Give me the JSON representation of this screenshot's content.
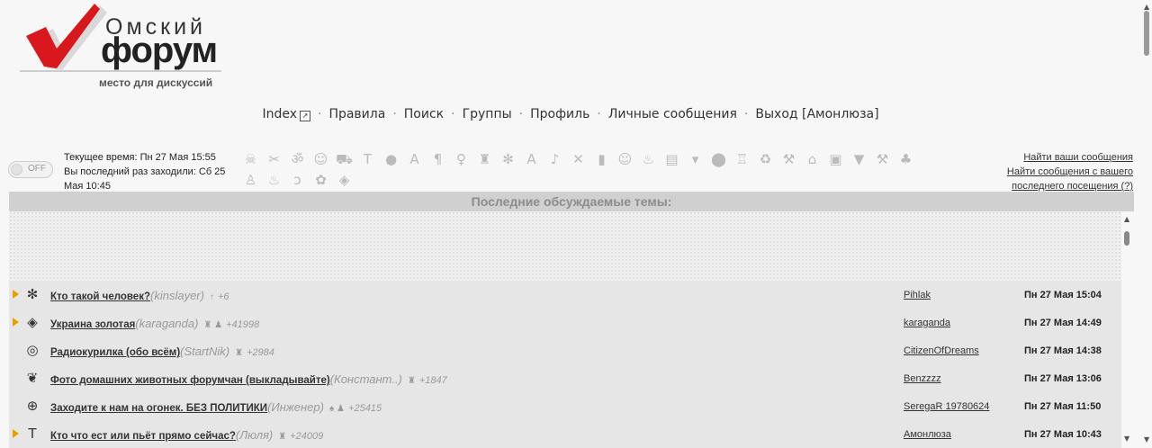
{
  "logo": {
    "small": "Омский",
    "big": "форум",
    "tagline": "место для дискуссий"
  },
  "nav": {
    "items": [
      {
        "label": "Index"
      },
      {
        "label": "Правила"
      },
      {
        "label": "Поиск"
      },
      {
        "label": "Группы"
      },
      {
        "label": "Профиль"
      },
      {
        "label": "Личные сообщения"
      },
      {
        "label": "Выход [Амонлюза]"
      }
    ],
    "separator": "·"
  },
  "toggle": {
    "label": "OFF"
  },
  "timeinfo": {
    "current": "Текущее время: Пн 27 Мая 15:55",
    "last_visit": "Вы последний раз заходили: Сб 25 Мая 10:45"
  },
  "icons": [
    "skull-icon",
    "scissors-icon",
    "om-icon",
    "cherub-icon",
    "car-icon",
    "t-icon",
    "bomb-icon",
    "figure-icon",
    "pilcrow-icon",
    "ribbon-icon",
    "robot-icon",
    "fan-icon",
    "letter-a-icon",
    "note-icon",
    "man-icon",
    "glass-icon",
    "smile-icon",
    "steam-icon",
    "books-icon",
    "mug-icon",
    "ball-icon",
    "castle-icon",
    "recycle-icon",
    "gavel-icon",
    "house-icon",
    "tractor-icon",
    "bin-icon",
    "axe-icon",
    "clubs-icon",
    "tower-icon",
    "fire-icon",
    "ear-icon",
    "plant-icon",
    "cube-icon"
  ],
  "links": {
    "find_own": "Найти ваши сообщения",
    "find_since": "Найти сообщения с вашего последнего посещения (?)"
  },
  "panel": {
    "title": "Последние обсуждаемые темы:"
  },
  "topics": [
    {
      "title": "Кто такой человек?",
      "author": "(kinslayer)",
      "count": "+6",
      "user": "Pihlak",
      "date": "Пн 27 Мая 15:04",
      "unread": true,
      "icon": "fan-icon"
    },
    {
      "title": "Украина золотая",
      "author": "(karaganda)",
      "count": "+41998",
      "user": "karaganda",
      "date": "Пн 27 Мая 14:49",
      "unread": true,
      "icon": "cube-icon"
    },
    {
      "title": "Радиокурилка (обо всём)",
      "author": "(StartNik)",
      "count": "+2984",
      "user": "CitizenOfDreams",
      "date": "Пн 27 Мая 14:38",
      "unread": false,
      "icon": "target-icon"
    },
    {
      "title": "Фото домашних животных форумчан (выкладывайте)",
      "author": "(Констант..)",
      "count": "+1847",
      "user": "Benzzzz",
      "date": "Пн 27 Мая 13:06",
      "unread": false,
      "icon": "cat-icon"
    },
    {
      "title": "Заходите к нам на огонек. БЕЗ ПОЛИТИКИ",
      "author": "(Инженер)",
      "count": "+25415",
      "user": "SeregaR 19780624",
      "date": "Пн 27 Мая 11:50",
      "unread": false,
      "icon": "crosshair-icon"
    },
    {
      "title": "Кто что ест или пьёт прямо сейчас?",
      "author": "(Люля)",
      "count": "+24009",
      "user": "Амонлюза",
      "date": "Пн 27 Мая 10:43",
      "unread": true,
      "icon": "t-icon"
    }
  ]
}
